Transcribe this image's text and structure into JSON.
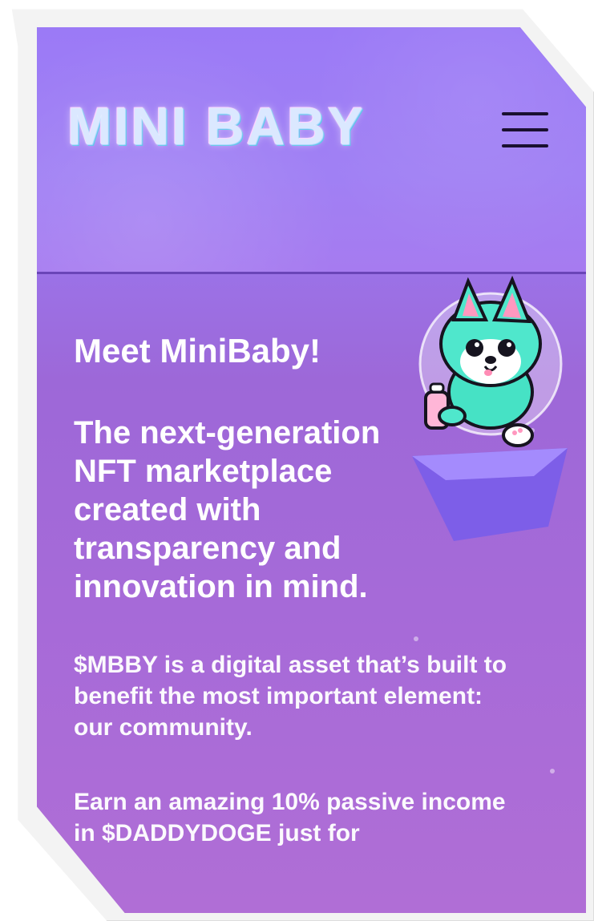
{
  "header": {
    "logo_text": "MINI BABY",
    "menu_icon": "hamburger-menu-icon"
  },
  "hero": {
    "title": "Meet MiniBaby!",
    "subtitle": "The next-generation NFT marketplace created with transparency and innovation in mind."
  },
  "body": {
    "paragraph_1": "$MBBY is a digital asset that’s built to benefit the most important element: our community.",
    "paragraph_2": "Earn an amazing 10% passive income in $DADDYDOGE just for"
  },
  "colors": {
    "page_bg": "#9d68d8",
    "header_bg": "#a080f4",
    "header_border": "#6a45b8",
    "text": "#ffffff",
    "menu_icon": "#1a1030",
    "mascot_body": "#41e6c8",
    "mascot_platform": "#8a6cf0"
  },
  "mascot": {
    "icon": "mascot-fox-astronaut-icon"
  }
}
